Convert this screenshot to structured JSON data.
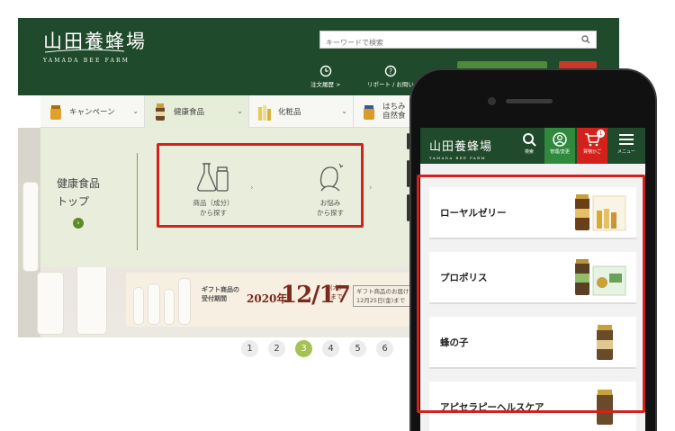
{
  "desktop": {
    "logo": {
      "main": "山田養蜂場",
      "sub": "YAMADA BEE FARM"
    },
    "search": {
      "placeholder": "キーワードで検索",
      "icon": "search-icon"
    },
    "util": [
      {
        "label": "注文履歴 >",
        "icon": "history-icon"
      },
      {
        "label": "リポート / お問い",
        "icon": "help-icon"
      }
    ],
    "nav": [
      {
        "label": "キャンペーン",
        "icon": "honey-jar-icon"
      },
      {
        "label": "健康食品",
        "icon": "supplement-bottle-icon"
      },
      {
        "label": "化粧品",
        "icon": "cosmetics-icon"
      },
      {
        "label": "はちみ 自然食",
        "icon": "honey-icon"
      }
    ],
    "mega": {
      "title_line1": "健康食品",
      "title_line2": "トップ",
      "options": [
        {
          "line1": "商品（成分）",
          "line2": "から探す",
          "icon": "flask-icon"
        },
        {
          "line1": "お悩み",
          "line2": "から探す",
          "icon": "person-concern-icon"
        }
      ]
    },
    "promo": {
      "label_line1": "ギフト商品の",
      "label_line2": "受付期間",
      "year": "2020年",
      "date": "12/17",
      "weekday": "(木)",
      "until": "まで",
      "deliver_line1": "ギフト商品のお届けは",
      "deliver_line2": "12月25日(金)まで"
    },
    "pager": {
      "pages": [
        "1",
        "2",
        "3",
        "4",
        "5",
        "6"
      ],
      "active": "3"
    }
  },
  "mobile": {
    "logo": {
      "main": "山田養蜂場",
      "sub": "YAMADA BEE FARM"
    },
    "header_icons": [
      {
        "label": "検索",
        "icon": "search-icon"
      },
      {
        "label": "管理/変更",
        "icon": "user-icon"
      },
      {
        "label": "買物かご",
        "icon": "cart-icon",
        "badge": "1"
      },
      {
        "label": "メニュー",
        "icon": "menu-icon"
      }
    ],
    "categories": [
      {
        "label": "ローヤルゼリー",
        "icon": "royal-jelly-product-icon"
      },
      {
        "label": "プロポリス",
        "icon": "propolis-product-icon"
      },
      {
        "label": "蜂の子",
        "icon": "bee-larva-product-icon"
      },
      {
        "label": "アピセラピーヘルスケア",
        "icon": "apitherapy-product-icon"
      }
    ]
  },
  "colors": {
    "brand_green": "#1f4a2b",
    "highlight_red": "#d3221c",
    "active_page": "#a6c254"
  }
}
